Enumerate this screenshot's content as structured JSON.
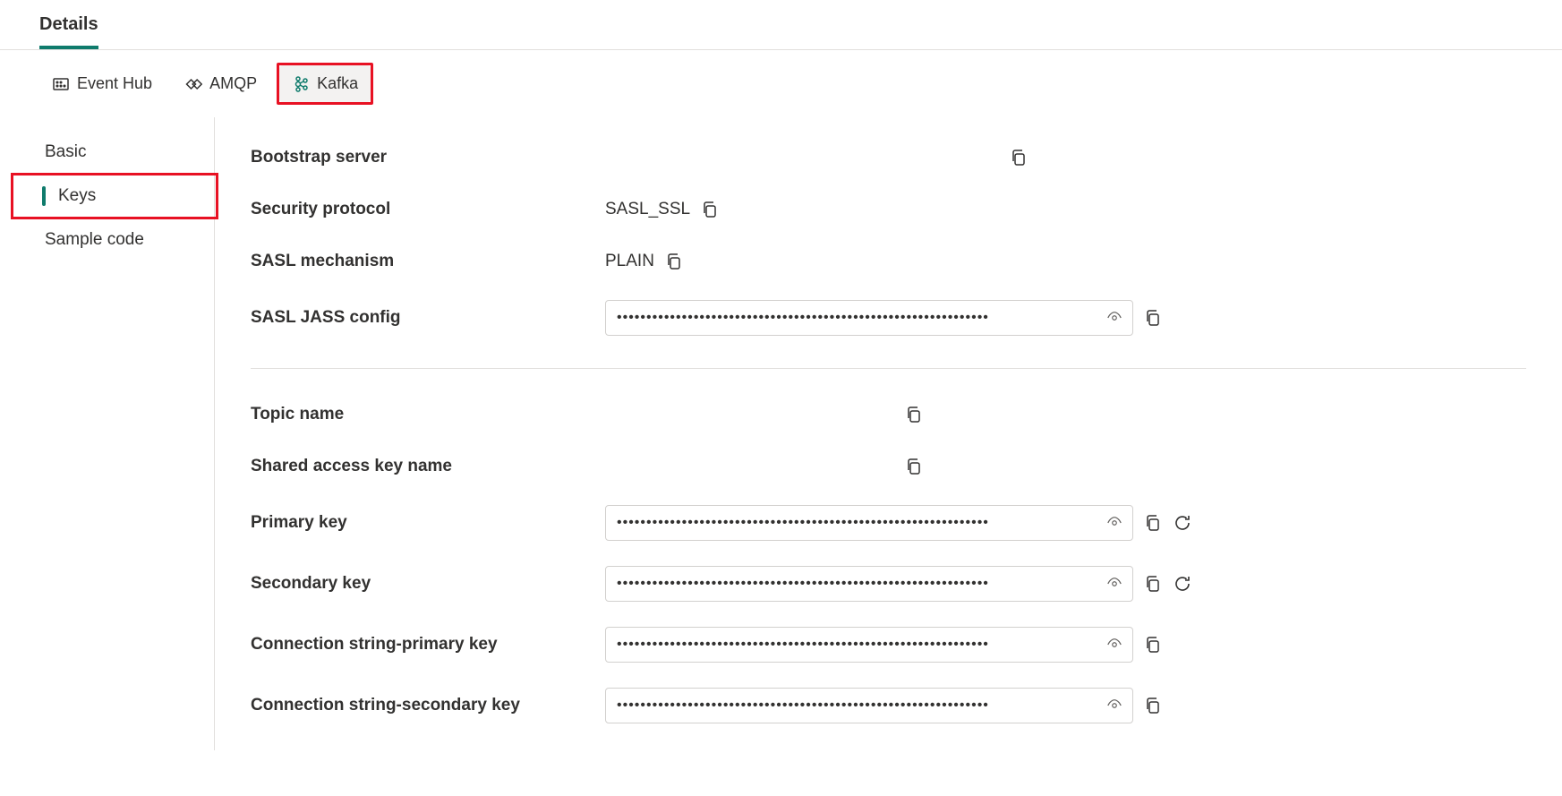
{
  "header": {
    "tab_label": "Details"
  },
  "protocol_tabs": [
    {
      "label": "Event Hub",
      "icon": "eventhub-icon",
      "active": false
    },
    {
      "label": "AMQP",
      "icon": "amqp-icon",
      "active": false
    },
    {
      "label": "Kafka",
      "icon": "kafka-icon",
      "active": true
    }
  ],
  "sidebar": {
    "items": [
      {
        "label": "Basic",
        "active": false
      },
      {
        "label": "Keys",
        "active": true
      },
      {
        "label": "Sample code",
        "active": false
      }
    ]
  },
  "fields": {
    "bootstrap_server": {
      "label": "Bootstrap server",
      "value": ""
    },
    "security_protocol": {
      "label": "Security protocol",
      "value": "SASL_SSL"
    },
    "sasl_mechanism": {
      "label": "SASL mechanism",
      "value": "PLAIN"
    },
    "sasl_jass_config": {
      "label": "SASL JASS config",
      "masked": "•••••••••••••••••••••••••••••••••••••••••••••••••••••••••••••••"
    },
    "topic_name": {
      "label": "Topic name",
      "value": ""
    },
    "shared_access_key_name": {
      "label": "Shared access key name",
      "value": ""
    },
    "primary_key": {
      "label": "Primary key",
      "masked": "•••••••••••••••••••••••••••••••••••••••••••••••••••••••••••••••"
    },
    "secondary_key": {
      "label": "Secondary key",
      "masked": "•••••••••••••••••••••••••••••••••••••••••••••••••••••••••••••••"
    },
    "connection_string_primary": {
      "label": "Connection string-primary key",
      "masked": "•••••••••••••••••••••••••••••••••••••••••••••••••••••••••••••••"
    },
    "connection_string_secondary": {
      "label": "Connection string-secondary key",
      "masked": "•••••••••••••••••••••••••••••••••••••••••••••••••••••••••••••••"
    }
  },
  "annotations": {
    "kafka_highlighted": true,
    "keys_highlighted": true
  }
}
